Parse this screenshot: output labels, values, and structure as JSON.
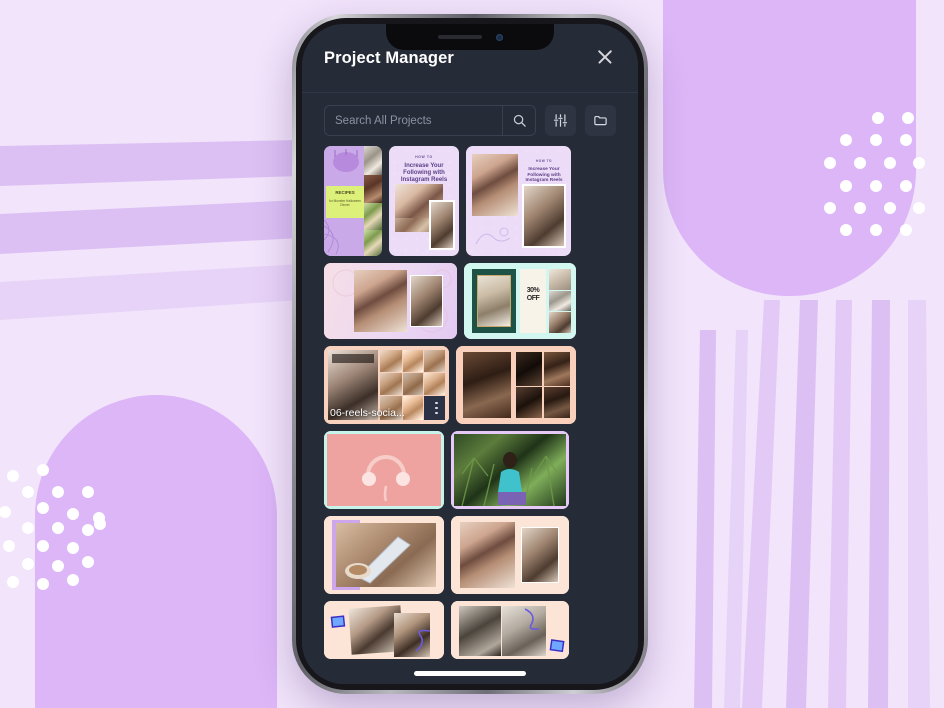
{
  "background": {
    "base_color": "#f2e4fb",
    "accent_color": "#d9b6f5",
    "stripe_light": "#f6ecfd",
    "dot_color": "#ffffff"
  },
  "phone": {
    "notch": {
      "speaker": "speaker-grille",
      "camera": "front-camera"
    },
    "home_indicator": "home-indicator"
  },
  "app": {
    "theme": {
      "background": "#262b38",
      "panel": "#2e3442",
      "border": "#3a4050",
      "text": "#ffffff",
      "muted": "#8d92a3"
    },
    "header": {
      "title": "Project Manager",
      "close_icon": "close-icon"
    },
    "search": {
      "placeholder": "Search All Projects",
      "value": "",
      "search_icon": "search-icon",
      "filter_icon": "sliders-filter-icon",
      "folder_icon": "folder-icon"
    },
    "grid": {
      "rows": [
        {
          "items": [
            {
              "name": "recipes-halloween-story",
              "label": "",
              "type": "story-tall"
            },
            {
              "name": "how-to-instagram-reels-story",
              "label": "",
              "headline_small": "HOW TO",
              "headline": "Increase Your Following with Instagram Reels",
              "type": "story"
            },
            {
              "name": "how-to-instagram-reels-post",
              "label": "",
              "headline_small": "HOW TO",
              "headline": "Increase Your Following with Instagram Reels",
              "type": "post"
            }
          ]
        },
        {
          "items": [
            {
              "name": "lifestyle-duo-lavender",
              "label": "",
              "type": "post"
            },
            {
              "name": "fashion-sale-mint",
              "label": "",
              "headline": "30% OFF",
              "type": "post"
            }
          ]
        },
        {
          "items": [
            {
              "name": "06-reels-social-bakery",
              "label": "06-reels-socia...",
              "type": "post",
              "has_menu": true
            },
            {
              "name": "architecture-moodboard-peach",
              "label": "",
              "type": "post"
            }
          ]
        },
        {
          "items": [
            {
              "name": "pink-headphones-mint-frame",
              "label": "",
              "type": "post"
            },
            {
              "name": "palm-portrait-lavender-frame",
              "label": "",
              "type": "post"
            }
          ]
        },
        {
          "items": [
            {
              "name": "phone-coffee-peach",
              "label": "",
              "type": "post"
            },
            {
              "name": "workspace-duo-peach",
              "label": "",
              "type": "post"
            }
          ]
        },
        {
          "items": [
            {
              "name": "selfie-collage-peach",
              "label": "",
              "type": "post"
            },
            {
              "name": "outfit-collage-peach",
              "label": "",
              "type": "post"
            }
          ]
        }
      ]
    }
  }
}
